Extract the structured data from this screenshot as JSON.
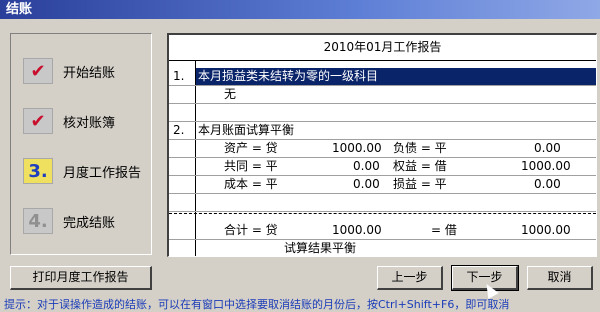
{
  "window": {
    "title": "结账"
  },
  "steps": [
    {
      "label": "开始结账",
      "icon": "✔",
      "icon_name": "check-pencil-icon"
    },
    {
      "label": "核对账簿",
      "icon": "✔",
      "icon_name": "check-pencil-icon"
    },
    {
      "label": "月度工作报告",
      "icon": "3.",
      "icon_name": "step-3-icon"
    },
    {
      "label": "完成结账",
      "icon": "4.",
      "icon_name": "step-4-icon"
    }
  ],
  "report": {
    "title": "2010年01月工作报告",
    "item1_num": "1.",
    "item1_label": "本月损益类未结转为零的一级科目",
    "item1_value": "无",
    "item2_num": "2.",
    "item2_label": "本月账面试算平衡",
    "assets_label": "资产 = 贷",
    "assets_value": "1000.00",
    "liab_label": "负债 = 平",
    "liab_value": "0.00",
    "common_label": "共同 = 平",
    "common_value": "0.00",
    "equity_label": "权益 = 借",
    "equity_value": "1000.00",
    "cost_label": "成本 = 平",
    "cost_value": "0.00",
    "pl_label": "损益 = 平",
    "pl_value": "0.00",
    "total_label": "合计 = 贷",
    "total_value": "1000.00",
    "total2_label": "= 借",
    "total2_value": "1000.00",
    "result": "试算结果平衡"
  },
  "buttons": {
    "print": "打印月度工作报告",
    "prev": "上一步",
    "next": "下一步",
    "cancel": "取消"
  },
  "hint": "提示：对于误操作造成的结账，可以在有窗口中选择要取消结账的月份后，按Ctrl+Shift+F6，即可取消"
}
